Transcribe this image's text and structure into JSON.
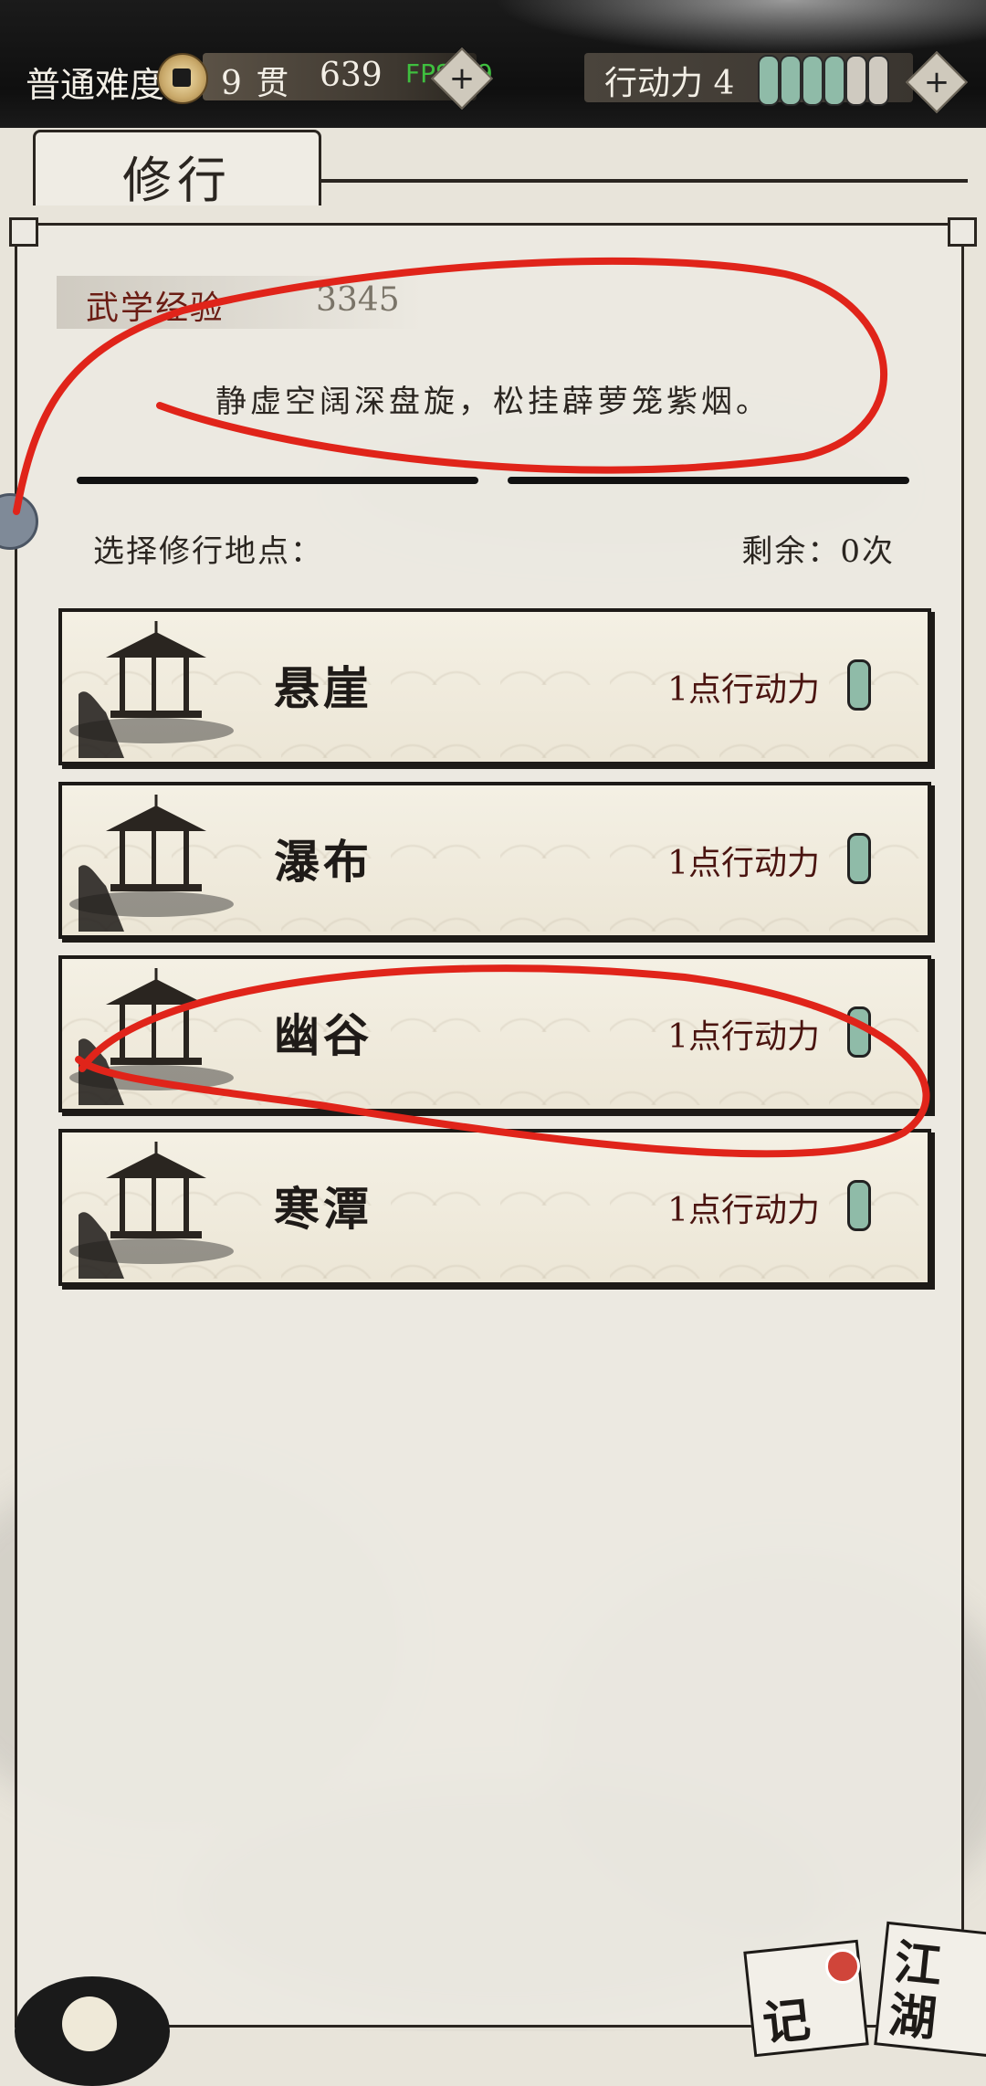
{
  "top_bar": {
    "difficulty": "普通难度",
    "currency_unit": "9 贯",
    "currency_amount": "639",
    "fps_overlay": "FPS:59",
    "action_points_label": "行动力 4",
    "action_points_bars_total": 6,
    "action_points_bars_filled": 4,
    "colors": {
      "filled": "#8fbba8",
      "empty": "#cfcac0"
    }
  },
  "tab": {
    "label": "修行"
  },
  "panel": {
    "exp_label": "武学经验",
    "exp_value": "3345",
    "poem": "静虚空阔深盘旋，松挂薜萝笼紫烟。",
    "select_label": "选择修行地点：",
    "remaining_label": "剩余：0次"
  },
  "locations": [
    {
      "name": "悬崖",
      "cost": "1点行动力"
    },
    {
      "name": "瀑布",
      "cost": "1点行动力"
    },
    {
      "name": "幽谷",
      "cost": "1点行动力"
    },
    {
      "name": "寒潭",
      "cost": "1点行动力"
    }
  ],
  "bottom_right": {
    "note_1": "记",
    "note_2_top": "江",
    "note_2_bottom": "湖"
  },
  "annotation_color": "#e0241a"
}
